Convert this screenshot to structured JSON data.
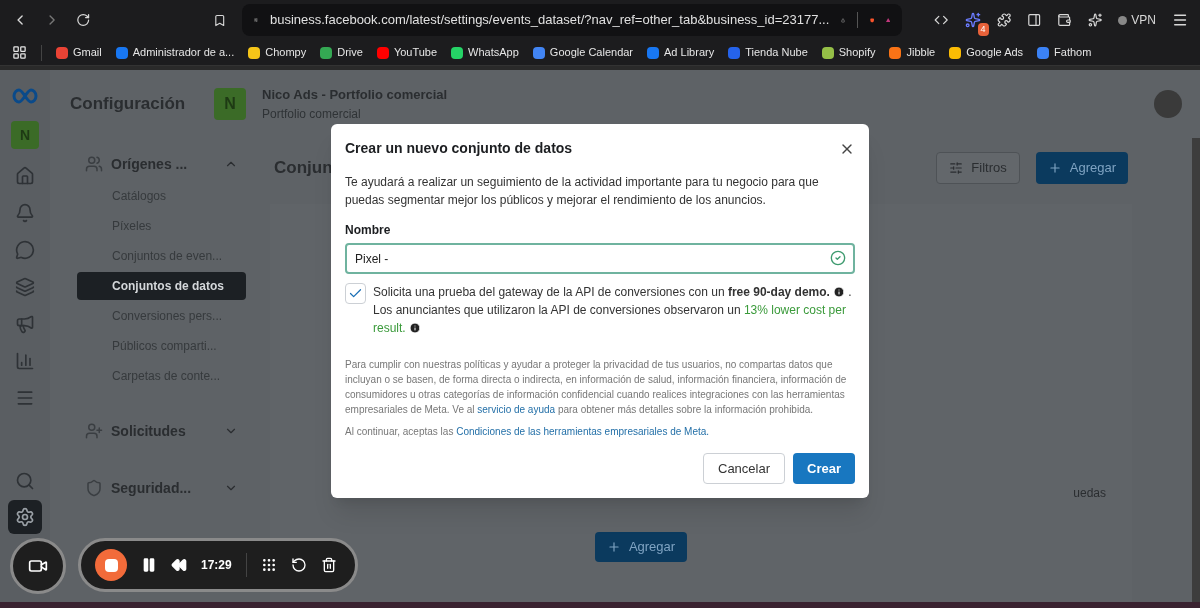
{
  "browser": {
    "url": "business.facebook.com/latest/settings/events_dataset/?nav_ref=other_tab&business_id=23177...",
    "extension_badge": "4",
    "vpn_label": "VPN",
    "bookmarks": [
      {
        "label": "Gmail"
      },
      {
        "label": "Administrador de a..."
      },
      {
        "label": "Chompy"
      },
      {
        "label": "Drive"
      },
      {
        "label": "YouTube"
      },
      {
        "label": "WhatsApp"
      },
      {
        "label": "Google Calendar"
      },
      {
        "label": "Ad Library"
      },
      {
        "label": "Tienda Nube"
      },
      {
        "label": "Shopify"
      },
      {
        "label": "Jibble"
      },
      {
        "label": "Google Ads"
      },
      {
        "label": "Fathom"
      }
    ]
  },
  "header": {
    "title": "Configuración",
    "business_initial": "N",
    "business_name": "Nico Ads - Portfolio comercial",
    "business_subtitle": "Portfolio comercial"
  },
  "rail": {
    "initial": "N"
  },
  "sidebar": [
    {
      "label": "Orígenes ...",
      "expanded": true,
      "items": [
        {
          "label": "Catálogos",
          "selected": false
        },
        {
          "label": "Píxeles",
          "selected": false
        },
        {
          "label": "Conjuntos de even...",
          "selected": false
        },
        {
          "label": "Conjuntos de datos",
          "selected": true
        },
        {
          "label": "Conversiones pers...",
          "selected": false
        },
        {
          "label": "Públicos comparti...",
          "selected": false
        },
        {
          "label": "Carpetas de conte...",
          "selected": false
        }
      ]
    },
    {
      "label": "Solicitudes",
      "expanded": false
    },
    {
      "label": "Seguridad...",
      "expanded": false
    }
  ],
  "content": {
    "title": "Conjun",
    "filters_button": "Filtros",
    "add_button": "Agregar",
    "empty_text_fragment": "uedas",
    "empty_add_button": "Agregar"
  },
  "modal": {
    "title": "Crear un nuevo conjunto de datos",
    "description": "Te ayudará a realizar un seguimiento de la actividad importante para tu negocio para que puedas segmentar mejor los públicos y mejorar el rendimiento de los anuncios.",
    "field": {
      "label": "Nombre",
      "value": "Pixel - ",
      "valid": true
    },
    "consent": {
      "checked": true,
      "parts": [
        {
          "kind": "text",
          "text": "Solicita una prueba del gateway de la API de conversiones con un **free 90-day demo.**"
        },
        {
          "kind": "info"
        },
        {
          "kind": "text",
          "text": ". Los anunciantes que utilizaron la API de conversiones observaron un"
        },
        {
          "kind": "highlight",
          "text": "13% lower cost per result."
        },
        {
          "kind": "info"
        }
      ]
    },
    "notice": {
      "before": "Para cumplir con nuestras políticas y ayudar a proteger la privacidad de tus usuarios, no compartas datos que incluyan o se basen, de forma directa o indirecta, en información de salud, información financiera, información de consumidores u otras categorías de información confidencial cuando realices integraciones con las herramientas empresariales de Meta. Ve al",
      "link": "servicio de ayuda",
      "after": "para obtener más detalles sobre la información prohibida."
    },
    "terms": {
      "before": "Al continuar, aceptas las",
      "link": "Condiciones de las herramientas empresariales de Meta."
    },
    "cancel_button": "Cancelar",
    "create_button": "Crear"
  },
  "recorder": {
    "time": "17:29"
  }
}
